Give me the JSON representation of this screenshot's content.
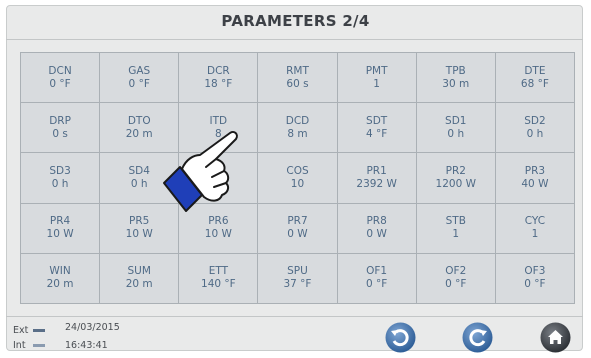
{
  "title": "PARAMETERS 2/4",
  "parameters": [
    {
      "code": "DCN",
      "value": "0 °F"
    },
    {
      "code": "GAS",
      "value": "0 °F"
    },
    {
      "code": "DCR",
      "value": "18 °F"
    },
    {
      "code": "RMT",
      "value": "60 s"
    },
    {
      "code": "PMT",
      "value": "1"
    },
    {
      "code": "TPB",
      "value": "30 m"
    },
    {
      "code": "DTE",
      "value": "68 °F"
    },
    {
      "code": "DRP",
      "value": "0 s"
    },
    {
      "code": "DTO",
      "value": "20 m"
    },
    {
      "code": "ITD",
      "value": "8"
    },
    {
      "code": "DCD",
      "value": "8 m"
    },
    {
      "code": "SDT",
      "value": "4 °F"
    },
    {
      "code": "SD1",
      "value": "0 h"
    },
    {
      "code": "SD2",
      "value": "0 h"
    },
    {
      "code": "SD3",
      "value": "0 h"
    },
    {
      "code": "SD4",
      "value": "0 h"
    },
    {
      "code": "",
      "value": "°F"
    },
    {
      "code": "COS",
      "value": "10"
    },
    {
      "code": "PR1",
      "value": "2392 W"
    },
    {
      "code": "PR2",
      "value": "1200 W"
    },
    {
      "code": "PR3",
      "value": "40 W"
    },
    {
      "code": "PR4",
      "value": "10 W"
    },
    {
      "code": "PR5",
      "value": "10 W"
    },
    {
      "code": "PR6",
      "value": "10 W"
    },
    {
      "code": "PR7",
      "value": "0 W"
    },
    {
      "code": "PR8",
      "value": "0 W"
    },
    {
      "code": "STB",
      "value": "1"
    },
    {
      "code": "CYC",
      "value": "1"
    },
    {
      "code": "WIN",
      "value": "20 m"
    },
    {
      "code": "SUM",
      "value": "20 m"
    },
    {
      "code": "ETT",
      "value": "140 °F"
    },
    {
      "code": "SPU",
      "value": "37 °F"
    },
    {
      "code": "OF1",
      "value": "0 °F"
    },
    {
      "code": "OF2",
      "value": "0 °F"
    },
    {
      "code": "OF3",
      "value": "0 °F"
    }
  ],
  "footer": {
    "ext_label": "Ext",
    "int_label": "Int",
    "ext_color": "#5a6f88",
    "int_color": "#8a9bb0",
    "date": "24/03/2015",
    "time": "16:43:41"
  },
  "nav": {
    "back_icon": "undo-arrow-icon",
    "forward_icon": "redo-arrow-icon",
    "home_icon": "home-icon",
    "button_color": "#3f6fa8"
  }
}
